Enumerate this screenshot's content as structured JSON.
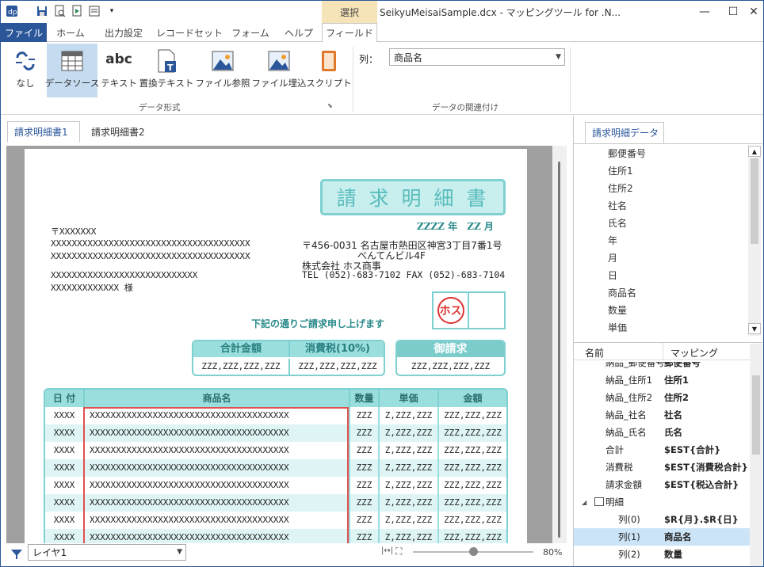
{
  "window": {
    "title": "SeikyuMeisaiSample.dcx - マッピングツール for .N...",
    "context_tab": "選択"
  },
  "tabs": [
    "ファイル",
    "ホーム",
    "出力設定",
    "レコードセット",
    "フォーム",
    "ヘルプ",
    "フィールド"
  ],
  "ribbon": {
    "buttons": [
      "なし",
      "データソース",
      "テキスト",
      "置換テキスト",
      "ファイル参照",
      "ファイル埋込",
      "スクリプト"
    ],
    "group1": "データ形式",
    "group2": "データの関連付け",
    "column_label": "列：",
    "column_value": "商品名",
    "abc": "abc"
  },
  "doc_tabs": [
    "請求明細書1",
    "請求明細書2"
  ],
  "invoice": {
    "title": "請 求 明 細 書",
    "date": "ZZZZ 年　ZZ 月",
    "postal": "〒XXXXXXX",
    "addr1": "XXXXXXXXXXXXXXXXXXXXXXXXXXXXXXXXXXXXXX",
    "addr2": "XXXXXXXXXXXXXXXXXXXXXXXXXXXXXXXXXXXXXX",
    "company_name": "XXXXXXXXXXXXXXXXXXXXXXXXXXXX",
    "person": "XXXXXXXXXXXXX 様",
    "sender_addr": "〒456-0031 名古屋市熱田区神宮3丁目7番1号",
    "sender_bldg": "べんてんビル4F",
    "sender_company": "株式会社 ホス商事",
    "sender_tel": "TEL (052)-683-7102 FAX (052)-683-7104",
    "stamp": "ホス",
    "message": "下記の通りご請求申し上げます",
    "total_label": "合計金額",
    "tax_label": "消費税(10%)",
    "billing_label": "御請求",
    "amount": "ZZZ,ZZZ,ZZZ,ZZZ",
    "headers": [
      "日 付",
      "商品名",
      "数量",
      "単価",
      "金額"
    ],
    "row": {
      "date": "XXXX",
      "item": "XXXXXXXXXXXXXXXXXXXXXXXXXXXXXXXXXXXXXX",
      "qty": "ZZZ",
      "price": "Z,ZZZ,ZZZ",
      "amount": "ZZZ,ZZZ,ZZZ"
    },
    "row_count": 8
  },
  "status": {
    "layer": "レイヤ1",
    "zoom": "80%",
    "zoom_level": 0.5
  },
  "right_panel": {
    "tab": "請求明細データ",
    "fields": [
      "郵便番号",
      "住所1",
      "住所2",
      "社名",
      "氏名",
      "年",
      "月",
      "日",
      "商品名",
      "数量",
      "単価"
    ],
    "col_name": "名前",
    "col_mapping": "マッピング",
    "mappings": [
      {
        "name": "納品_郵便番号",
        "mapping": "郵便番号"
      },
      {
        "name": "納品_住所1",
        "mapping": "住所1"
      },
      {
        "name": "納品_住所2",
        "mapping": "住所2"
      },
      {
        "name": "納品_社名",
        "mapping": "社名"
      },
      {
        "name": "納品_氏名",
        "mapping": "氏名"
      },
      {
        "name": "合計",
        "mapping": "$EST{合計}"
      },
      {
        "name": "消費税",
        "mapping": "$EST{消費税合計}"
      },
      {
        "name": "請求金額",
        "mapping": "$EST{税込合計}"
      },
      {
        "name": "明細",
        "mapping": ""
      },
      {
        "name": "列(0)",
        "mapping": "$R{月}.$R{日}"
      },
      {
        "name": "列(1)",
        "mapping": "商品名"
      },
      {
        "name": "列(2)",
        "mapping": "数量"
      }
    ]
  }
}
